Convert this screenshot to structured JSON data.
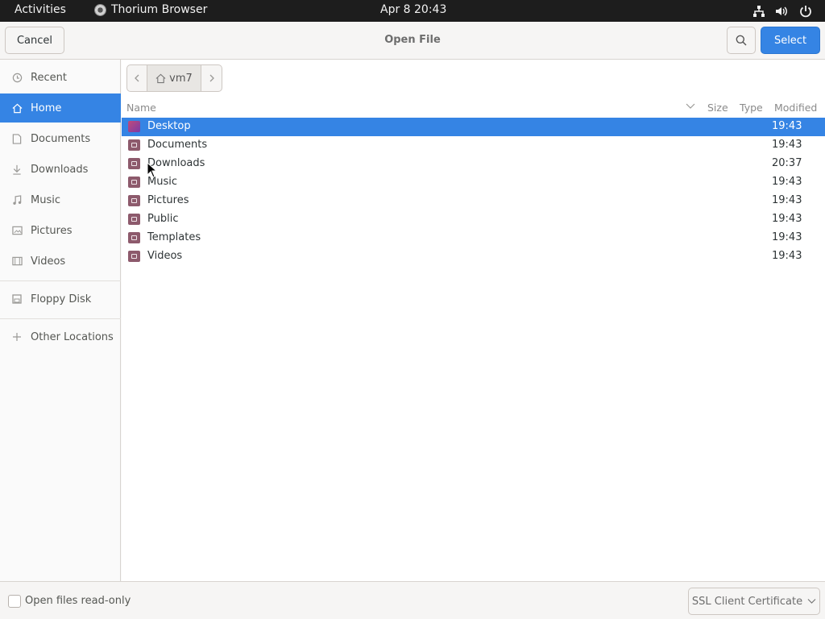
{
  "topbar": {
    "activities": "Activities",
    "app_name": "Thorium Browser",
    "clock": "Apr 8  20:43",
    "tray_icons": [
      "network-icon",
      "volume-icon",
      "power-icon"
    ]
  },
  "header": {
    "cancel_label": "Cancel",
    "title": "Open File",
    "select_label": "Select",
    "accent_color": "#3584e4"
  },
  "sidebar": {
    "items": [
      {
        "label": "Recent",
        "icon": "clock-icon"
      },
      {
        "label": "Home",
        "icon": "home-icon",
        "active": true
      },
      {
        "label": "Documents",
        "icon": "document-icon"
      },
      {
        "label": "Downloads",
        "icon": "download-icon"
      },
      {
        "label": "Music",
        "icon": "music-icon"
      },
      {
        "label": "Pictures",
        "icon": "picture-icon"
      },
      {
        "label": "Videos",
        "icon": "video-icon"
      },
      {
        "label": "Floppy Disk",
        "icon": "floppy-icon"
      },
      {
        "label": "Other Locations",
        "icon": "plus-icon"
      }
    ]
  },
  "pathbar": {
    "current": "vm7"
  },
  "columns": {
    "name": "Name",
    "size": "Size",
    "type": "Type",
    "modified": "Modified"
  },
  "files": [
    {
      "name": "Desktop",
      "modified": "19:43",
      "selected": true
    },
    {
      "name": "Documents",
      "modified": "19:43"
    },
    {
      "name": "Downloads",
      "modified": "20:37"
    },
    {
      "name": "Music",
      "modified": "19:43"
    },
    {
      "name": "Pictures",
      "modified": "19:43"
    },
    {
      "name": "Public",
      "modified": "19:43"
    },
    {
      "name": "Templates",
      "modified": "19:43"
    },
    {
      "name": "Videos",
      "modified": "19:43"
    }
  ],
  "footer": {
    "readonly_label": "Open files read-only",
    "filter_label": "SSL Client Certificate"
  }
}
